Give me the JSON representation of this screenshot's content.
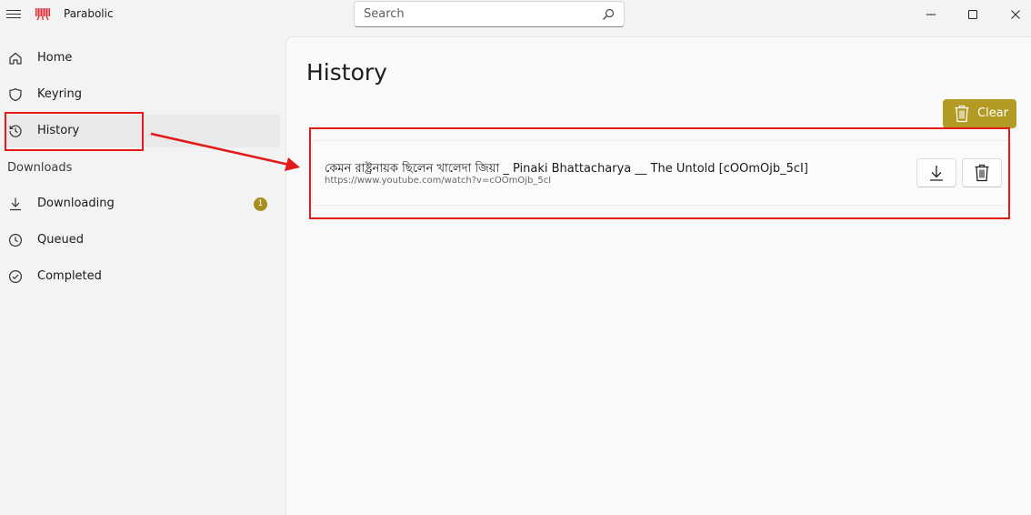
{
  "app": {
    "title": "Parabolic"
  },
  "search": {
    "placeholder": "Search"
  },
  "window_controls": {
    "minimize": "minimize-icon",
    "maximize": "maximize-icon",
    "close": "close-icon"
  },
  "sidebar": {
    "items": [
      {
        "label": "Home",
        "icon": "home-icon"
      },
      {
        "label": "Keyring",
        "icon": "shield-icon"
      },
      {
        "label": "History",
        "icon": "history-icon",
        "selected": true
      }
    ],
    "downloads_header": "Downloads",
    "download_items": [
      {
        "label": "Downloading",
        "icon": "download-icon",
        "badge": "1"
      },
      {
        "label": "Queued",
        "icon": "clock-icon"
      },
      {
        "label": "Completed",
        "icon": "check-circle-icon"
      }
    ]
  },
  "main": {
    "title": "History",
    "clear_label": "Clear",
    "history_items": [
      {
        "title": "কেমন রাষ্ট্রনায়ক ছিলেন খালেদা জিয়া _ Pinaki Bhattacharya __ The Untold [cOOmOjb_5cI]",
        "url": "https://www.youtube.com/watch?v=cOOmOjb_5cI"
      }
    ]
  },
  "colors": {
    "accent": "#b39a23",
    "annotation": "#e21a1a",
    "badge": "#a88f1d"
  }
}
